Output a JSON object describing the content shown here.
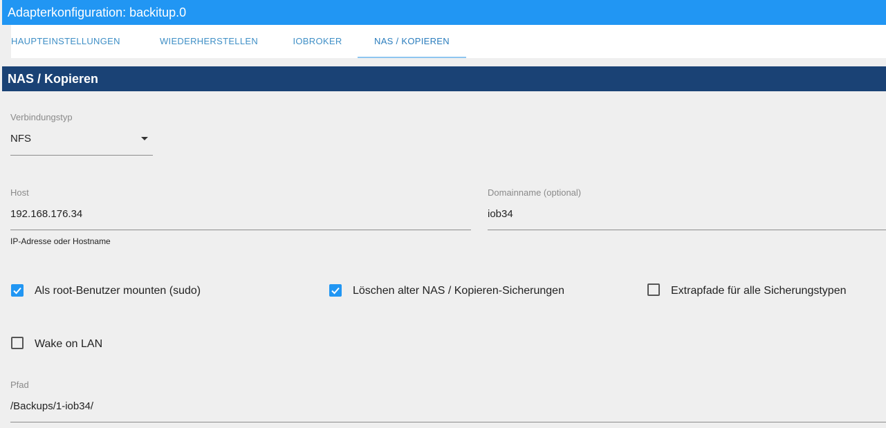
{
  "window": {
    "title": "Adapterkonfiguration: backitup.0"
  },
  "tabs": [
    {
      "label": "HAUPTEINSTELLUNGEN"
    },
    {
      "label": "WIEDERHERSTELLEN"
    },
    {
      "label": "IOBROKER"
    },
    {
      "label": "NAS / KOPIEREN",
      "active": true
    }
  ],
  "section": {
    "title": "NAS / Kopieren"
  },
  "connection_type": {
    "label": "Verbindungstyp",
    "value": "NFS",
    "icon": "caret-down-icon"
  },
  "host": {
    "label": "Host",
    "value": "192.168.176.34",
    "helper": "IP-Adresse oder Hostname"
  },
  "domain": {
    "label": "Domainname (optional)",
    "value": "iob34"
  },
  "options": {
    "sudo": {
      "label": "Als root-Benutzer mounten (sudo)",
      "checked": true
    },
    "delete_old": {
      "label": "Löschen alter NAS / Kopieren-Sicherungen",
      "checked": true
    },
    "extra_paths": {
      "label": "Extrapfade für alle Sicherungstypen",
      "checked": false
    },
    "wake_on_lan": {
      "label": "Wake on LAN",
      "checked": false
    }
  },
  "path": {
    "label": "Pfad",
    "value": "/Backups/1-iob34/"
  },
  "colors": {
    "accent": "#2196f3",
    "section_header": "#1a4275",
    "tab_text": "#3f8fc6"
  }
}
